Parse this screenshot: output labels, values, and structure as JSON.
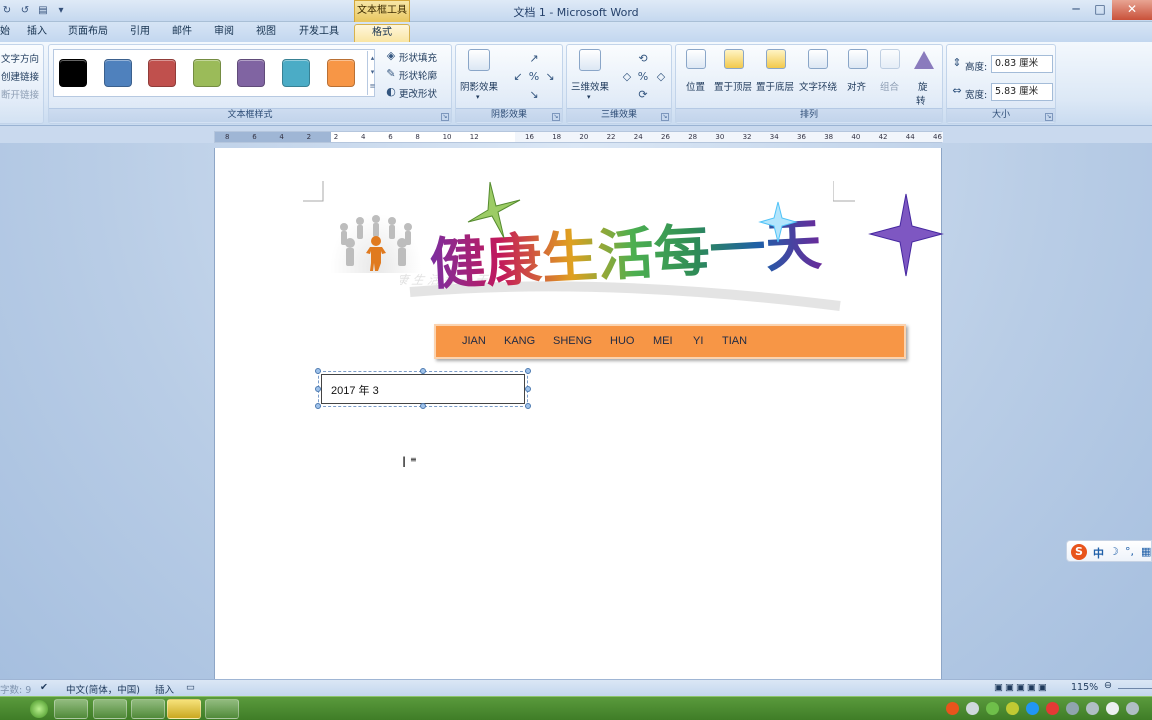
{
  "window": {
    "title": "文档 1 - Microsoft Word",
    "context_tab_title": "文本框工具"
  },
  "tabs": [
    {
      "label": "始"
    },
    {
      "label": "插入"
    },
    {
      "label": "页面布局"
    },
    {
      "label": "引用"
    },
    {
      "label": "邮件"
    },
    {
      "label": "审阅"
    },
    {
      "label": "视图"
    },
    {
      "label": "开发工具"
    },
    {
      "label": "格式"
    }
  ],
  "ribbon": {
    "text_group": {
      "items": [
        "文字方向",
        "创建链接",
        "断开链接"
      ]
    },
    "textbox_styles": {
      "label": "文本框样式",
      "swatches": [
        "#000000",
        "#4f81bd",
        "#c0504d",
        "#9bbb59",
        "#8064a2",
        "#4bacc6",
        "#f79646"
      ],
      "fill": "形状填充",
      "outline": "形状轮廓",
      "change": "更改形状"
    },
    "shadow": {
      "label": "阴影效果",
      "button": "阴影效果"
    },
    "threed": {
      "label": "三维效果",
      "button": "三维效果"
    },
    "arrange": {
      "label": "排列",
      "position": "位置",
      "bring_front": "置于顶层",
      "send_back": "置于底层",
      "wrap": "文字环绕",
      "align": "对齐",
      "group": "组合",
      "rotate_1": "旋",
      "rotate_2": "转"
    },
    "size": {
      "label": "大小",
      "height_label": "高度:",
      "height_value": "0.83 厘米",
      "width_label": "宽度:",
      "width_value": "5.83 厘米"
    }
  },
  "ruler": {
    "ticks": [
      "8",
      "6",
      "4",
      "2",
      "2",
      "4",
      "6",
      "8",
      "10",
      "12",
      "16",
      "18",
      "20",
      "22",
      "24",
      "26",
      "28",
      "30",
      "32",
      "34",
      "36",
      "38",
      "40",
      "42",
      "44",
      "46"
    ]
  },
  "document": {
    "wordart": "健康生活每一天",
    "wordart_colors": [
      "#7b2fa0",
      "#c2185b",
      "#e0a020",
      "#4caf50",
      "#2e8b57",
      "#1f5fa8",
      "#6a2a9a"
    ],
    "banner_words": [
      "JIAN",
      "KANG",
      "SHENG",
      "HUO",
      "MEI",
      "YI",
      "TIAN"
    ],
    "banner_color": "#f79646",
    "textbox_text": "2017 年 3"
  },
  "ime": {
    "label": "中"
  },
  "status": {
    "words": "字数: 9",
    "language": "中文(简体，中国)",
    "mode": "插入",
    "zoom": "115%"
  }
}
